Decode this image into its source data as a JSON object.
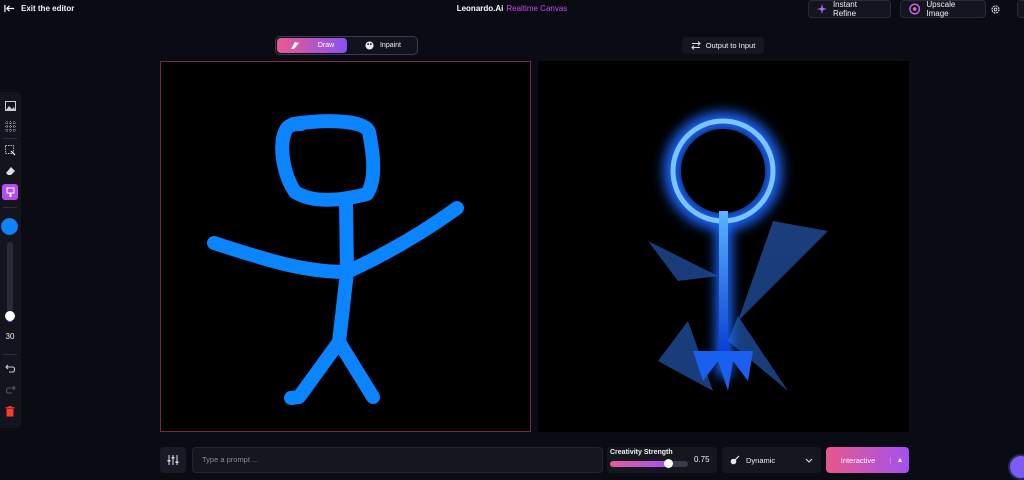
{
  "header": {
    "exit_label": "Exit the editor",
    "brand": "Leonardo.Ai",
    "subtitle": "Realtime Canvas",
    "instant_refine_label": "Instant Refine",
    "upscale_label": "Upscale Image"
  },
  "modes": {
    "draw_label": "Draw",
    "inpaint_label": "Inpaint",
    "active": "Draw"
  },
  "output_to_input_label": "Output to Input",
  "toolbar": {
    "tools": [
      "image-icon",
      "grid-icon",
      "select-icon",
      "eraser-icon",
      "brush-icon"
    ],
    "active_tool": "brush-icon",
    "brush_color": "#0a84ff",
    "brush_size": "30",
    "brush_size_fraction": 0.08
  },
  "bottom": {
    "prompt_placeholder": "Type a prompt ...",
    "creativity_label": "Creativity Strength",
    "creativity_value": "0.75",
    "style_label": "Dynamic",
    "interactive_label": "Interactive"
  },
  "colors": {
    "accent_pink": "#ea5a8f",
    "accent_purple": "#8a52f2",
    "canvas_border": "#7a2749",
    "stroke_blue": "#0a84ff"
  }
}
